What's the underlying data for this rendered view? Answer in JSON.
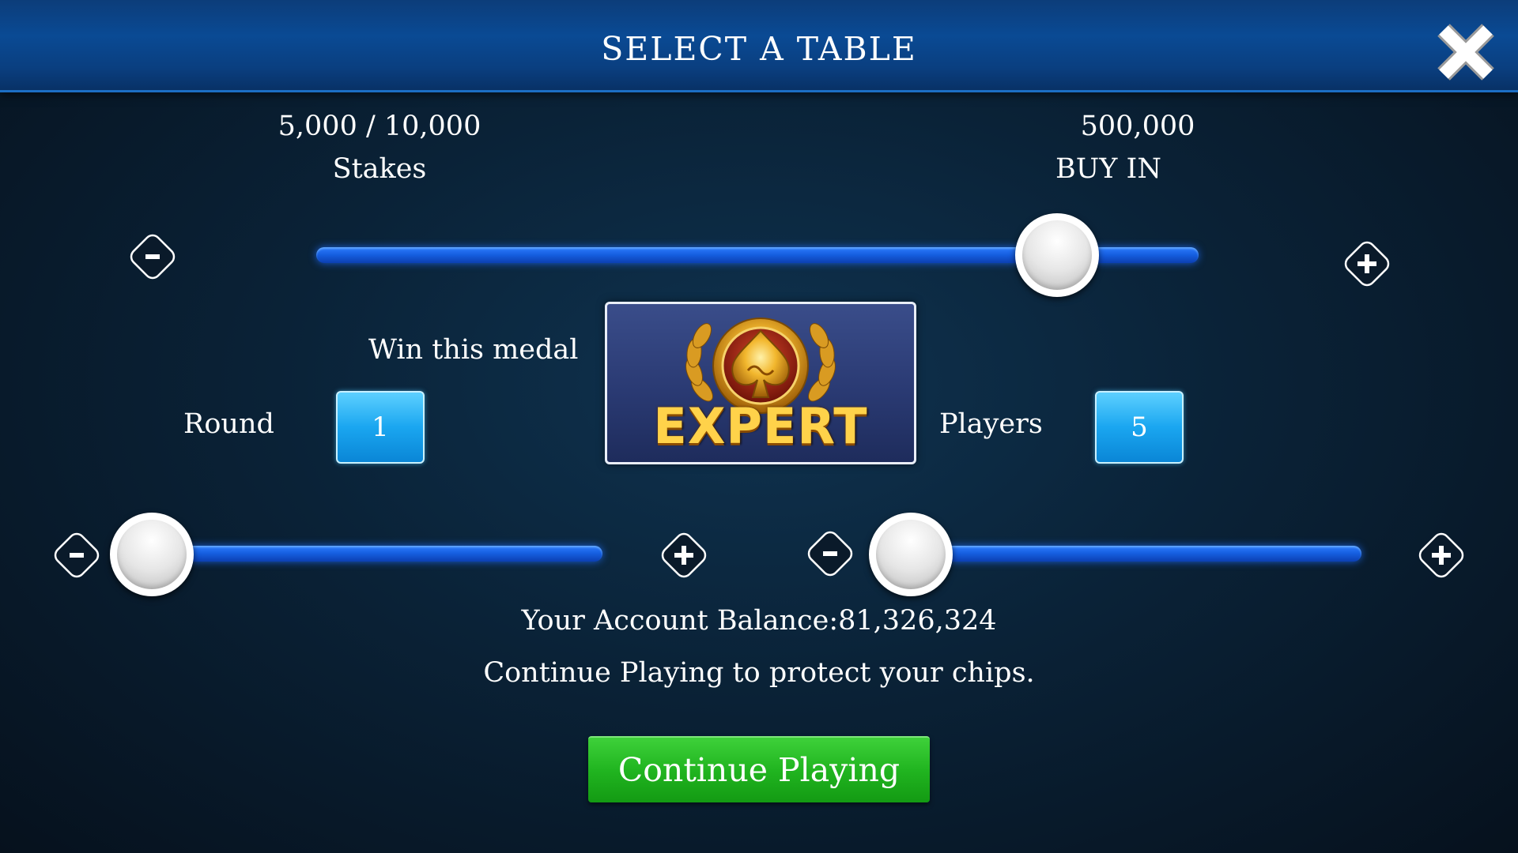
{
  "header": {
    "title": "SELECT A TABLE",
    "close_icon": "close-icon"
  },
  "stakes": {
    "value": "5,000 / 10,000",
    "label": "Stakes"
  },
  "buy_in": {
    "value": "500,000",
    "label": "BUY IN"
  },
  "stakes_slider": {
    "level": 0.84,
    "minus": "-",
    "plus": "+"
  },
  "medal": {
    "caption": "Win this medal",
    "word": "EXPERT"
  },
  "round": {
    "label": "Round",
    "value": "1"
  },
  "players": {
    "label": "Players",
    "value": "5"
  },
  "round_slider": {
    "level": 0.0
  },
  "players_slider": {
    "level": 0.0
  },
  "account": {
    "balance_text": "Your Account Balance:81,326,324",
    "hint": "Continue Playing to protect your chips."
  },
  "continue_button": {
    "label": "Continue Playing"
  },
  "colors": {
    "accent_blue": "#155dde",
    "button_green": "#21b520",
    "number_box": "#1aa6f0",
    "medal_gold": "#ffd24a"
  }
}
